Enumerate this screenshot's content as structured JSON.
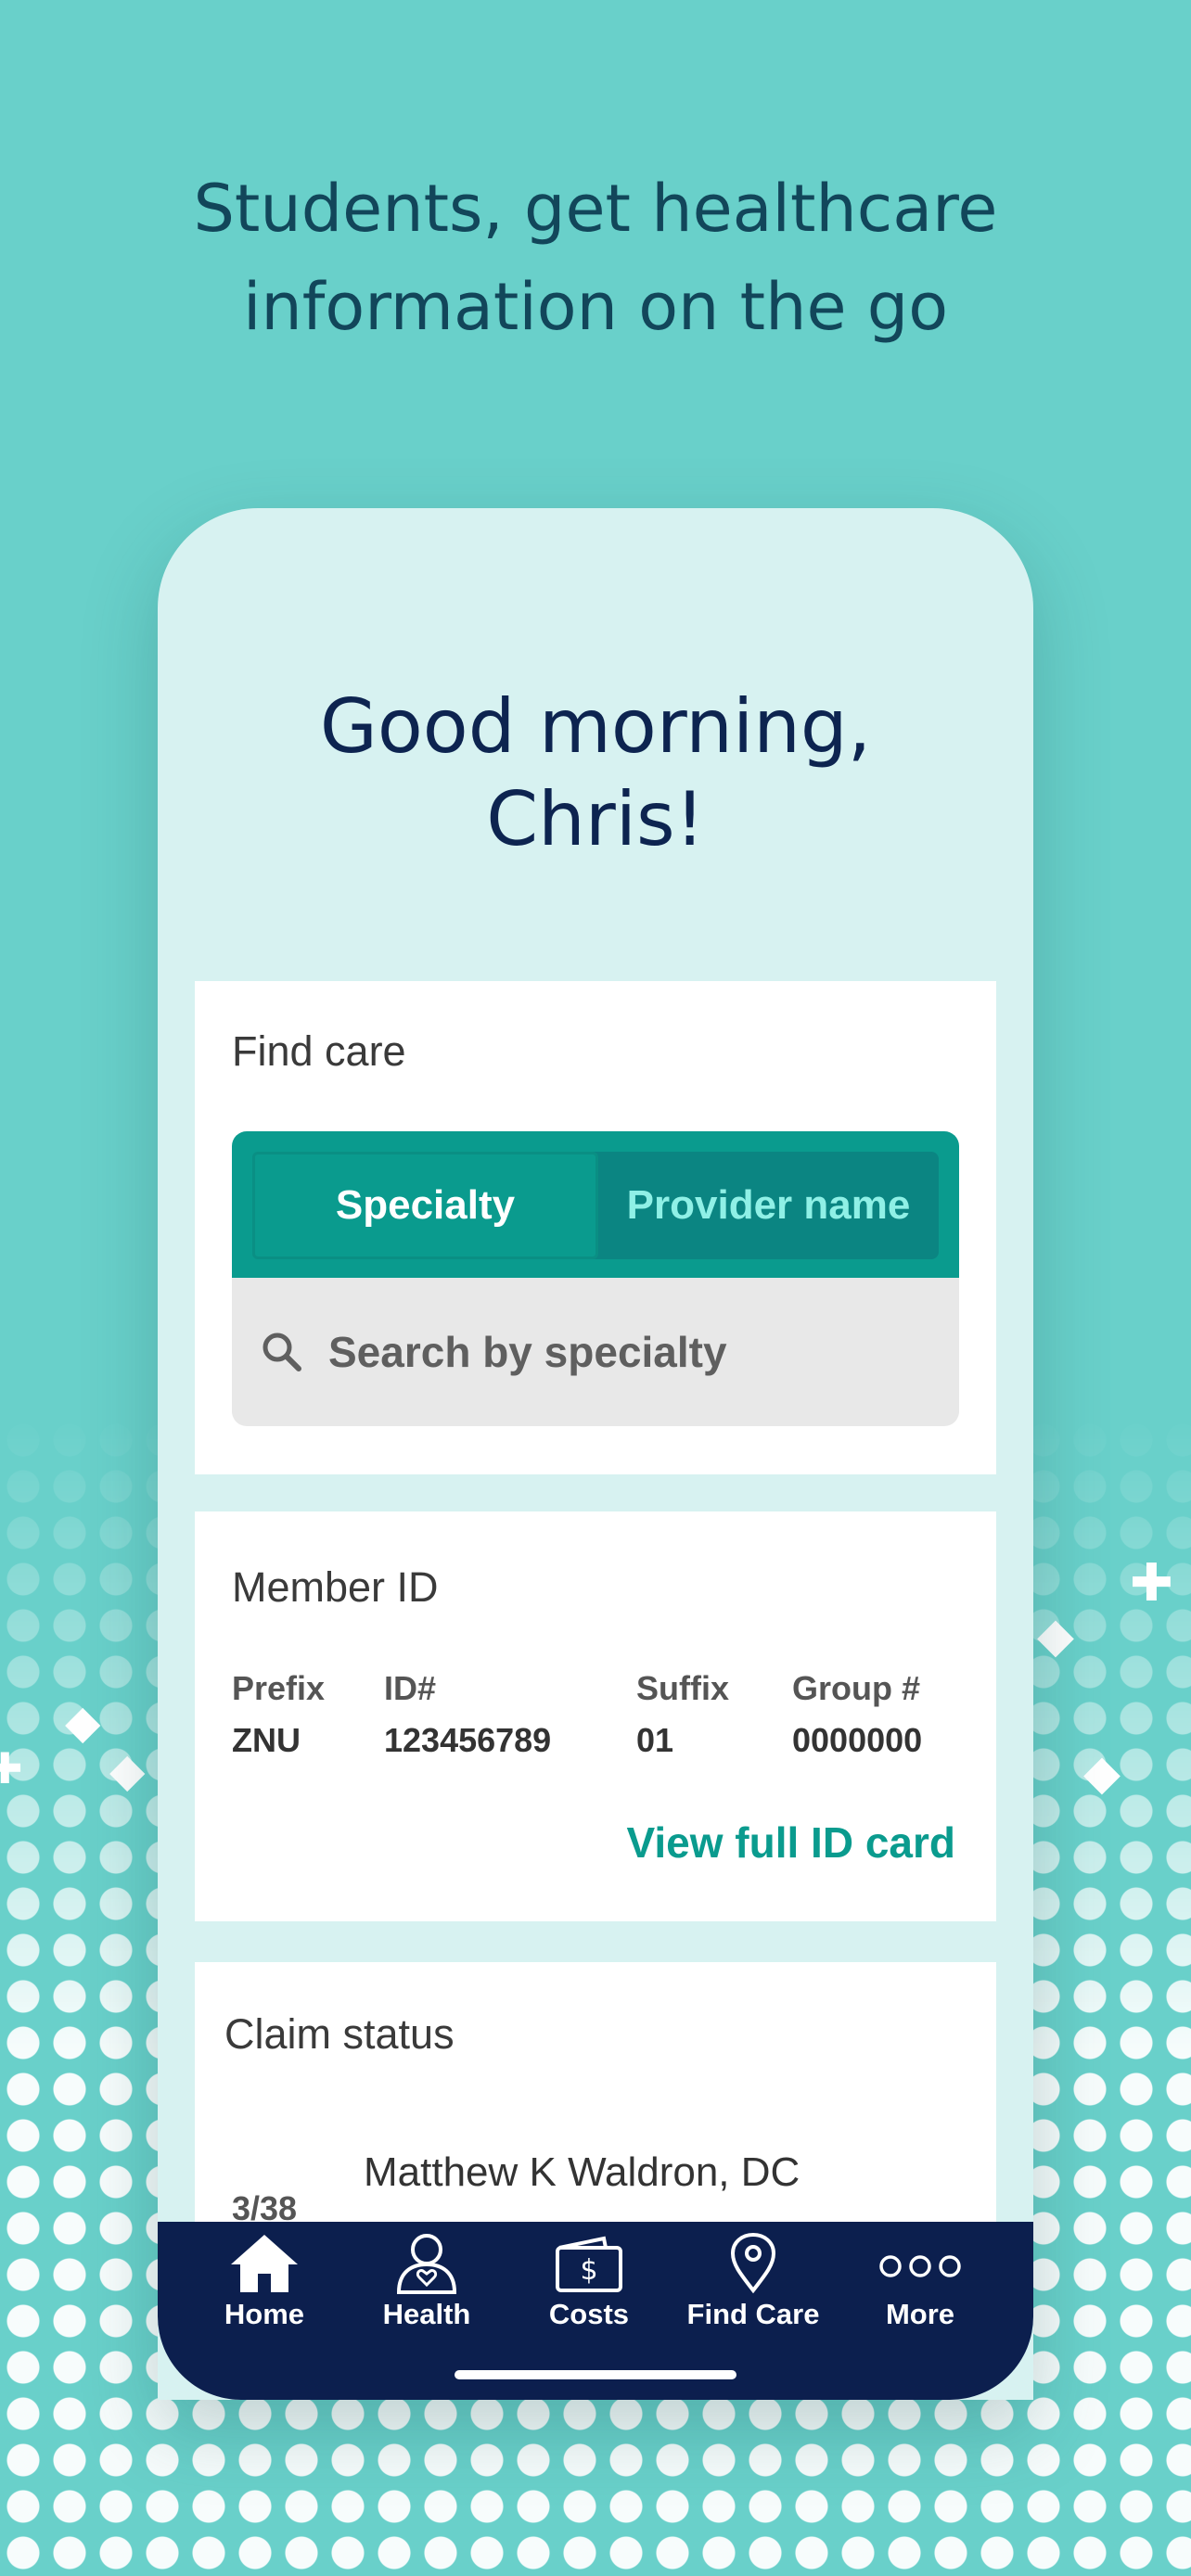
{
  "headline": {
    "line1": "Students, get healthcare",
    "line2": "information on the go"
  },
  "greeting": {
    "line1": "Good morning,",
    "line2": "Chris!"
  },
  "find_care": {
    "title": "Find care",
    "tabs": [
      {
        "label": "Specialty",
        "selected": true
      },
      {
        "label": "Provider name",
        "selected": false
      }
    ],
    "search_placeholder": "Search by specialty",
    "search_icon": "search-icon"
  },
  "member_id": {
    "title": "Member ID",
    "columns": [
      {
        "label": "Prefix",
        "value": "ZNU"
      },
      {
        "label": "ID#",
        "value": "123456789"
      },
      {
        "label": "Suffix",
        "value": "01"
      },
      {
        "label": "Group #",
        "value": "0000000"
      }
    ],
    "link": "View full ID card"
  },
  "claim_status": {
    "title": "Claim status",
    "claim": {
      "date": "3/38",
      "provider": "Matthew K Waldron, DC"
    }
  },
  "tab_bar": {
    "items": [
      {
        "label": "Home",
        "icon": "home-icon"
      },
      {
        "label": "Health",
        "icon": "person-heart-icon"
      },
      {
        "label": "Costs",
        "icon": "wallet-dollar-icon"
      },
      {
        "label": "Find Care",
        "icon": "location-pin-icon"
      },
      {
        "label": "More",
        "icon": "more-dots-icon"
      }
    ]
  },
  "colors": {
    "background": "#69d0ca",
    "teal_accent": "#0a9b8e",
    "navy": "#0c1f4e"
  }
}
